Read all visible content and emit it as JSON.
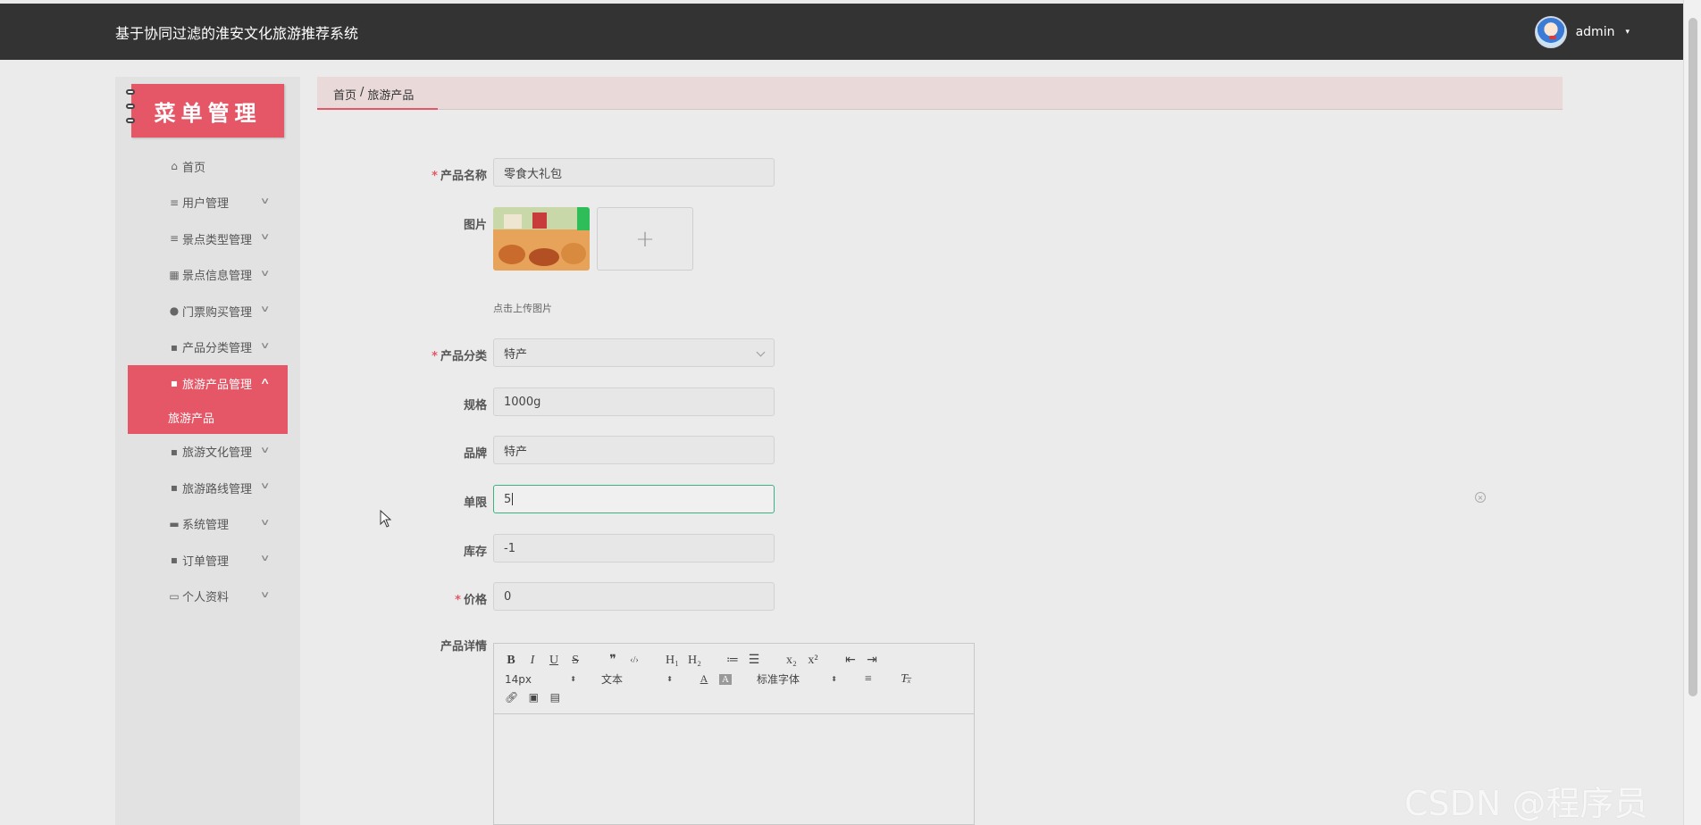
{
  "header": {
    "title": "基于协同过滤的淮安文化旅游推荐系统",
    "user": "admin"
  },
  "sidebar": {
    "banner": "菜单管理",
    "items": [
      {
        "label": "首页",
        "icon": "home-icon"
      },
      {
        "label": "用户管理",
        "icon": "list-icon"
      },
      {
        "label": "景点类型管理",
        "icon": "list-icon"
      },
      {
        "label": "景点信息管理",
        "icon": "grid-icon"
      },
      {
        "label": "门票购买管理",
        "icon": "user-icon"
      },
      {
        "label": "产品分类管理",
        "icon": "apps-icon"
      },
      {
        "label": "旅游产品管理",
        "icon": "apps-icon",
        "active": true
      },
      {
        "label": "旅游文化管理",
        "icon": "apps-icon"
      },
      {
        "label": "旅游路线管理",
        "icon": "apps-icon"
      },
      {
        "label": "系统管理",
        "icon": "monitor-icon"
      },
      {
        "label": "订单管理",
        "icon": "apps-icon"
      },
      {
        "label": "个人资料",
        "icon": "card-icon"
      }
    ],
    "submenu": "旅游产品"
  },
  "breadcrumb": {
    "home": "首页",
    "separator": "/",
    "current": "旅游产品"
  },
  "form": {
    "name_label": "产品名称",
    "name_value": "零食大礼包",
    "image_label": "图片",
    "upload_plus": "+",
    "upload_hint": "点击上传图片",
    "category_label": "产品分类",
    "category_value": "特产",
    "spec_label": "规格",
    "spec_value": "1000g",
    "brand_label": "品牌",
    "brand_value": "特产",
    "limit_label": "单限",
    "limit_value": "5",
    "stock_label": "库存",
    "stock_value": "-1",
    "price_label": "价格",
    "price_value": "0",
    "detail_label": "产品详情",
    "required_mark": "*"
  },
  "editor": {
    "font_size": "14px",
    "header_select": "文本",
    "font_family": "标准字体",
    "buttons_row1": [
      "B",
      "I",
      "U",
      "S",
      "❞",
      "‹/›",
      "H₁",
      "H₂",
      "≔",
      "☰",
      "x₂",
      "x²",
      "⇤",
      "⇥"
    ]
  },
  "watermark": "CSDN @程序员code",
  "colors": {
    "accent": "#e55766",
    "topbar": "#333333",
    "focus": "#3ab283"
  }
}
